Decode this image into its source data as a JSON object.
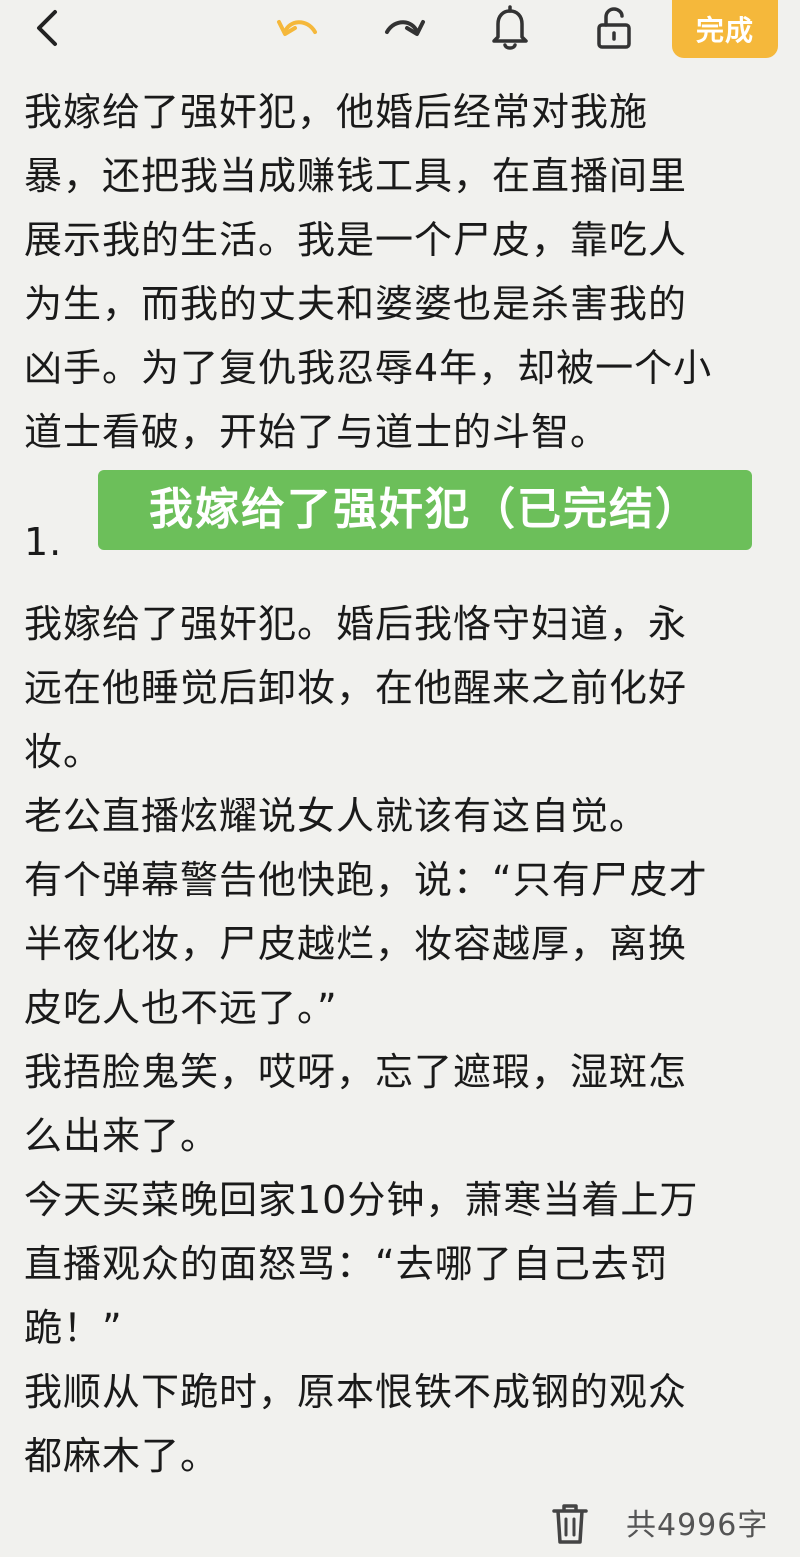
{
  "toolbar": {
    "back_icon": "chevron-left-icon",
    "undo_icon": "undo-icon",
    "redo_icon": "redo-icon",
    "notify_icon": "bell-icon",
    "lock_icon": "unlock-icon",
    "done_label": "完成",
    "accent_color": "#f5b83b",
    "undo_color": "#f5b83b"
  },
  "intro": {
    "lines": [
      "我嫁给了强奸犯，他婚后经常对我施",
      "暴，还把我当成赚钱工具，在直播间里",
      "展示我的生活。我是一个尸皮，靠吃人",
      "为生，而我的丈夫和婆婆也是杀害我的",
      "凶手。为了复仇我忍辱4年，却被一个小",
      "道士看破，开始了与道士的斗智。"
    ]
  },
  "chapter": {
    "number": "1.",
    "title_banner": "我嫁给了强奸犯（已完结）",
    "banner_color": "#6cbf5a"
  },
  "body": {
    "lines": [
      "我嫁给了强奸犯。婚后我恪守妇道，永",
      "远在他睡觉后卸妆，在他醒来之前化好",
      "妆。",
      "老公直播炫耀说女人就该有这自觉。",
      "有个弹幕警告他快跑，说：“只有尸皮才",
      "半夜化妆，尸皮越烂，妆容越厚，离换",
      "皮吃人也不远了。”",
      "我捂脸鬼笑，哎呀，忘了遮瑕，湿斑怎",
      "么出来了。",
      "今天买菜晚回家10分钟，萧寒当着上万",
      "直播观众的面怒骂：“去哪了自己去罚",
      "跪！”",
      "我顺从下跪时，原本恨铁不成钢的观众",
      "都麻木了。"
    ]
  },
  "footer": {
    "trash_icon": "trash-icon",
    "word_count": "共4996字"
  }
}
